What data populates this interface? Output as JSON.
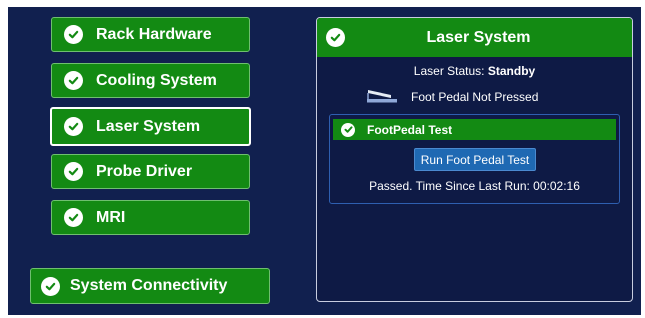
{
  "colors": {
    "background": "#11204f",
    "panel": "#0e1a45",
    "ok_green": "#138a13",
    "button_blue": "#1f69b3",
    "text": "#ffffff"
  },
  "nav": {
    "items": [
      {
        "label": "Rack Hardware",
        "icon": "check-circle-icon",
        "selected": false
      },
      {
        "label": "Cooling System",
        "icon": "check-circle-icon",
        "selected": false
      },
      {
        "label": "Laser System",
        "icon": "check-circle-icon",
        "selected": true
      },
      {
        "label": "Probe Driver",
        "icon": "check-circle-icon",
        "selected": false
      },
      {
        "label": "MRI",
        "icon": "check-circle-icon",
        "selected": false
      }
    ],
    "connectivity": {
      "label": "System Connectivity",
      "icon": "check-circle-icon"
    }
  },
  "panel": {
    "title": "Laser System",
    "icon": "check-circle-icon",
    "status_label": "Laser Status:",
    "status_value": "Standby",
    "pedal_icon": "foot-pedal-icon",
    "pedal_status": "Foot Pedal Not Pressed",
    "test": {
      "title": "FootPedal Test",
      "icon": "check-circle-icon",
      "run_button": "Run Foot Pedal Test",
      "result": "Passed. Time Since Last Run: 00:02:16"
    }
  }
}
